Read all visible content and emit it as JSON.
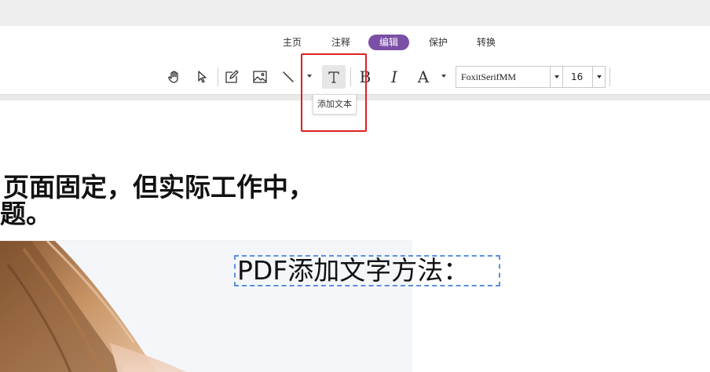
{
  "tabs": [
    {
      "label": "主页"
    },
    {
      "label": "注释"
    },
    {
      "label": "编辑"
    },
    {
      "label": "保护"
    },
    {
      "label": "转换"
    }
  ],
  "active_tab": "编辑",
  "toolbar": {
    "tools": [
      {
        "icon": "hand-icon"
      },
      {
        "icon": "pointer-icon"
      },
      {
        "icon": "edit-box-icon"
      },
      {
        "icon": "image-icon"
      },
      {
        "icon": "line-icon"
      },
      {
        "icon": "add-text-icon",
        "active": true
      },
      {
        "icon": "bold-icon",
        "glyph": "B"
      },
      {
        "icon": "italic-icon",
        "glyph": "I"
      },
      {
        "icon": "font-color-icon",
        "glyph": "A"
      }
    ],
    "font_name": "FoxitSerifMM",
    "font_size": "16"
  },
  "tooltip": "添加文本",
  "document": {
    "line1": "页面固定，但实际工作中，",
    "line2": "题。",
    "textbox_text": "PDF添加文字方法："
  },
  "colors": {
    "accent": "#7b4fa6",
    "highlight": "#e02020",
    "textbox_border": "#5b8fe0"
  }
}
